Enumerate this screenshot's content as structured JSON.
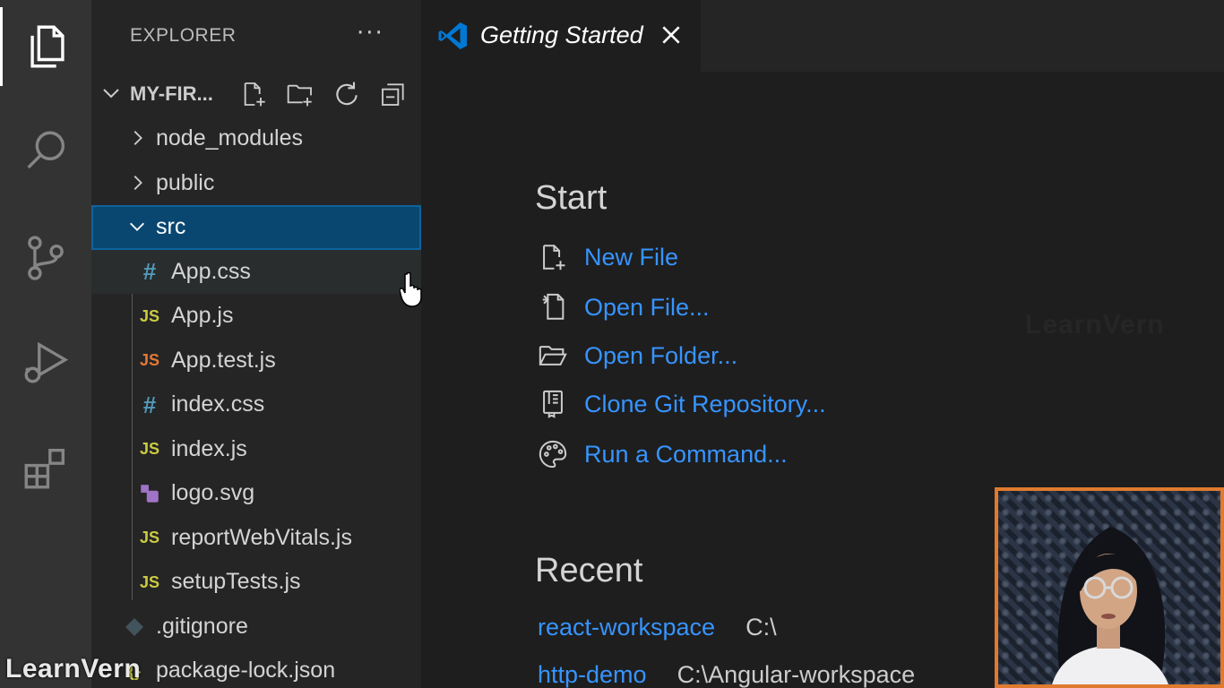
{
  "activity_bar": {
    "items": [
      {
        "name": "explorer",
        "icon": "files-icon",
        "active": true
      },
      {
        "name": "search",
        "icon": "search-icon",
        "active": false
      },
      {
        "name": "source-control",
        "icon": "source-control-icon",
        "active": false
      },
      {
        "name": "run-debug",
        "icon": "run-debug-icon",
        "active": false
      },
      {
        "name": "extensions",
        "icon": "extensions-icon",
        "active": false
      }
    ]
  },
  "sidebar": {
    "title": "EXPLORER",
    "more_label": "···",
    "project": {
      "name": "MY-FIR...",
      "actions": [
        "new-file-icon",
        "new-folder-icon",
        "refresh-icon",
        "collapse-all-icon"
      ]
    },
    "tree": [
      {
        "label": "node_modules",
        "kind": "folder",
        "expanded": false
      },
      {
        "label": "public",
        "kind": "folder",
        "expanded": false
      },
      {
        "label": "src",
        "kind": "folder",
        "expanded": true,
        "selected": true
      },
      {
        "label": "App.css",
        "kind": "file",
        "icon_text": "#",
        "icon_type": "css"
      },
      {
        "label": "App.js",
        "kind": "file",
        "icon_text": "JS",
        "icon_type": "js"
      },
      {
        "label": "App.test.js",
        "kind": "file",
        "icon_text": "JS",
        "icon_type": "js-test"
      },
      {
        "label": "index.css",
        "kind": "file",
        "icon_text": "#",
        "icon_type": "css"
      },
      {
        "label": "index.js",
        "kind": "file",
        "icon_text": "JS",
        "icon_type": "js"
      },
      {
        "label": "logo.svg",
        "kind": "file",
        "icon_text": "",
        "icon_type": "svg"
      },
      {
        "label": "reportWebVitals.js",
        "kind": "file",
        "icon_text": "JS",
        "icon_type": "js"
      },
      {
        "label": "setupTests.js",
        "kind": "file",
        "icon_text": "JS",
        "icon_type": "js"
      },
      {
        "label": ".gitignore",
        "kind": "rootfile",
        "icon_text": "",
        "icon_type": "git"
      },
      {
        "label": "package-lock.json",
        "kind": "rootfile",
        "icon_text": "",
        "icon_type": "json"
      }
    ]
  },
  "editor": {
    "tab": {
      "title": "Getting Started",
      "close_label": "✕"
    },
    "start": {
      "title": "Start",
      "items": [
        {
          "label": "New File",
          "icon": "new-file-icon"
        },
        {
          "label": "Open File...",
          "icon": "open-file-icon"
        },
        {
          "label": "Open Folder...",
          "icon": "open-folder-icon"
        },
        {
          "label": "Clone Git Repository...",
          "icon": "clone-repo-icon"
        },
        {
          "label": "Run a Command...",
          "icon": "run-command-icon"
        }
      ]
    },
    "recent": {
      "title": "Recent",
      "items": [
        {
          "name": "react-workspace",
          "path": "C:\\"
        },
        {
          "name": "http-demo",
          "path": "C:\\Angular-workspace"
        }
      ]
    }
  },
  "watermark": {
    "text": "LearnVern"
  },
  "colors": {
    "accent_link": "#3794ff",
    "selection": "#094771",
    "js_icon": "#cbcb41",
    "js_test_icon": "#e37933",
    "css_icon": "#519aba",
    "webcam_border": "#e07a2e"
  }
}
